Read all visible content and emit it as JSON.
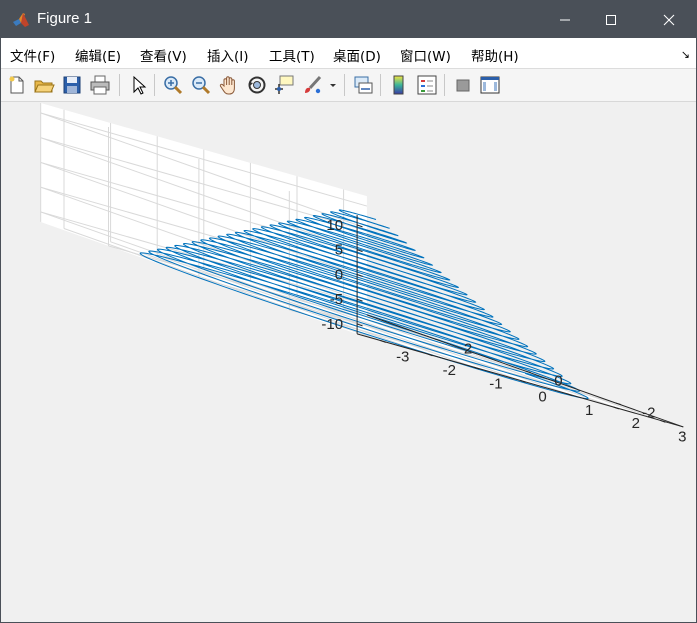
{
  "window": {
    "title": "Figure 1",
    "app_icon": "matlab-logo-icon",
    "controls": [
      "minimize-icon",
      "maximize-icon",
      "close-icon"
    ]
  },
  "menu": {
    "items": [
      "文件(F)",
      "编辑(E)",
      "查看(V)",
      "插入(I)",
      "工具(T)",
      "桌面(D)",
      "窗口(W)",
      "帮助(H)"
    ],
    "dock_arrow": "↘"
  },
  "toolbar": {
    "icons": [
      "new-figure-icon",
      "open-file-icon",
      "save-icon",
      "print-icon",
      "edit-plot-arrow-icon",
      "zoom-in-icon",
      "zoom-out-icon",
      "pan-hand-icon",
      "rotate-3d-icon",
      "data-cursor-icon",
      "brush-icon",
      "brush-dropdown-icon",
      "link-plot-icon",
      "colorbar-icon",
      "legend-icon",
      "hide-plot-tools-icon",
      "show-plot-tools-icon"
    ]
  },
  "colors": {
    "titlebar": "#4a5058",
    "line": "#0072bd",
    "grid": "#d9d9d9",
    "axis": "#262626"
  },
  "chart_data": {
    "type": "line",
    "projection": "3d",
    "curve": "conical helix: x = r·cos(t), y = r·sin(t), z decreasing; radius shrinks with height",
    "x_ticks": [
      "-3",
      "-2",
      "-1",
      "0",
      "1",
      "2",
      "3"
    ],
    "y_ticks": [
      "-2",
      "0",
      "2"
    ],
    "z_ticks": [
      "-10",
      "-5",
      "0",
      "5",
      "10"
    ],
    "xlim": [
      -3.5,
      3.5
    ],
    "ylim": [
      -3.5,
      3.5
    ],
    "zlim": [
      -12,
      12
    ],
    "z_range": [
      -12.5,
      10
    ],
    "radius_range": [
      0.3,
      3.5
    ],
    "turns": 24,
    "grid": true
  }
}
